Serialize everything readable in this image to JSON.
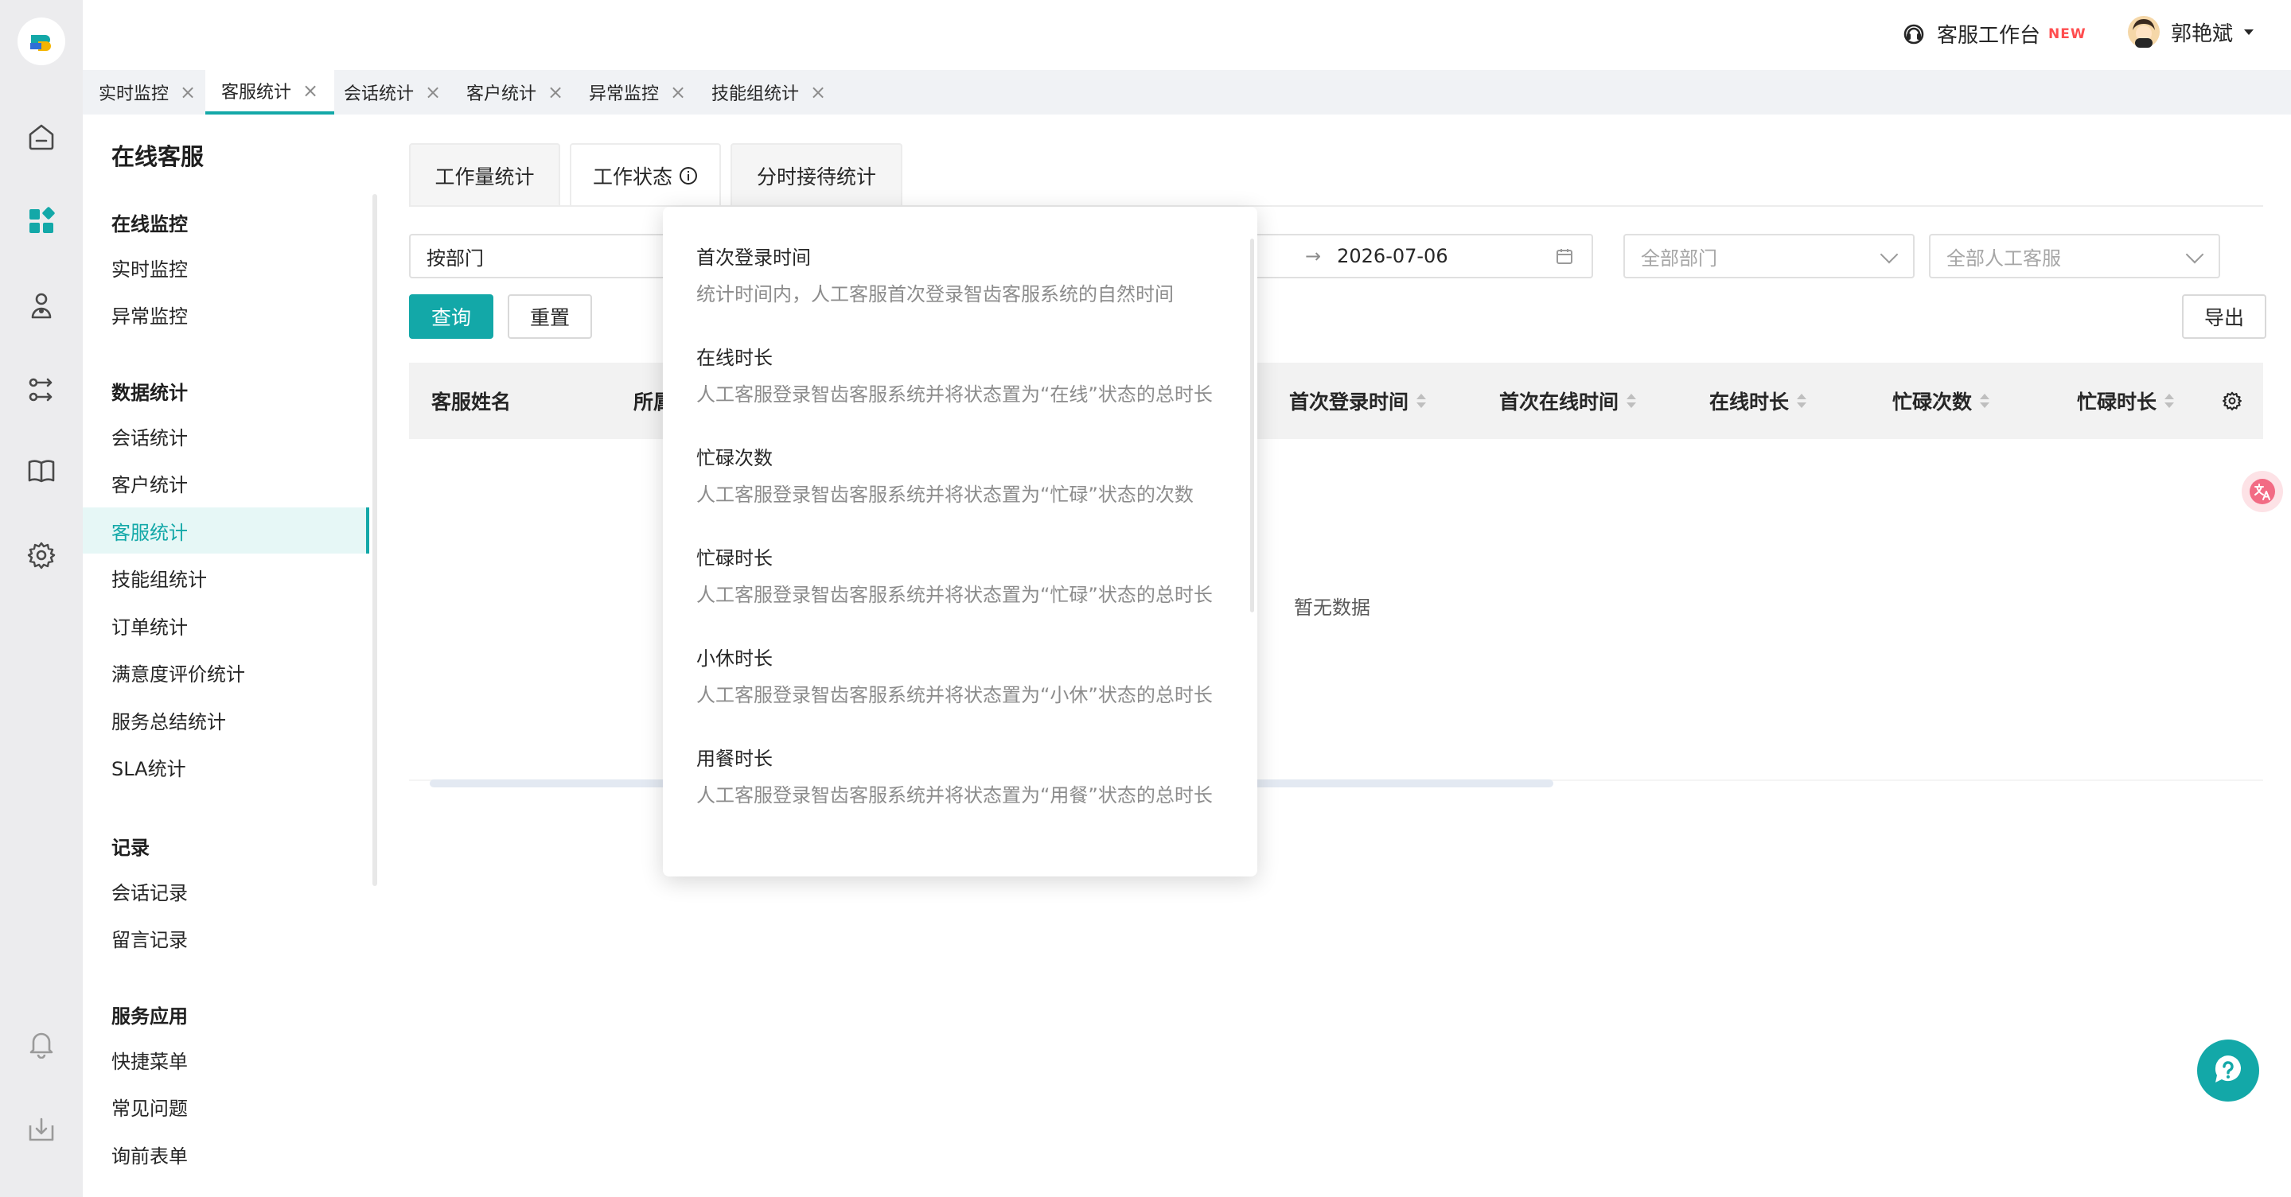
{
  "topbar": {
    "workbench_label": "客服工作台",
    "new_badge": "NEW",
    "user_name": "郭艳斌"
  },
  "page_tabs": [
    {
      "label": "实时监控",
      "active": false
    },
    {
      "label": "客服统计",
      "active": true
    },
    {
      "label": "会话统计",
      "active": false
    },
    {
      "label": "客户统计",
      "active": false
    },
    {
      "label": "异常监控",
      "active": false
    },
    {
      "label": "技能组统计",
      "active": false
    }
  ],
  "menu": {
    "title": "在线客服",
    "groups": [
      {
        "label": "在线监控",
        "items": [
          "实时监控",
          "异常监控"
        ]
      },
      {
        "label": "数据统计",
        "items": [
          "会话统计",
          "客户统计",
          "客服统计",
          "技能组统计",
          "订单统计",
          "满意度评价统计",
          "服务总结统计",
          "SLA统计"
        ]
      },
      {
        "label": "记录",
        "items": [
          "会话记录",
          "留言记录"
        ]
      },
      {
        "label": "服务应用",
        "items": [
          "快捷菜单",
          "常见问题",
          "询前表单"
        ]
      }
    ],
    "active_item": "客服统计"
  },
  "subtabs": [
    {
      "label": "工作量统计",
      "active": false
    },
    {
      "label": "工作状态",
      "active": true
    },
    {
      "label": "分时接待统计",
      "active": false
    }
  ],
  "filters": {
    "group_by": "按部门",
    "date_end": "2026-07-06",
    "date_separator": "→",
    "department_placeholder": "全部部门",
    "agent_placeholder": "全部人工客服"
  },
  "buttons": {
    "query": "查询",
    "reset": "重置",
    "export": "导出"
  },
  "table": {
    "columns": [
      "客服姓名",
      "所属",
      "首次登录时间",
      "首次在线时间",
      "在线时长",
      "忙碌次数",
      "忙碌时长"
    ],
    "empty_text": "暂无数据"
  },
  "popover": {
    "items": [
      {
        "title": "首次登录时间",
        "desc": "统计时间内，人工客服首次登录智齿客服系统的自然时间"
      },
      {
        "title": "在线时长",
        "desc": "人工客服登录智齿客服系统并将状态置为“在线”状态的总时长"
      },
      {
        "title": "忙碌次数",
        "desc": "人工客服登录智齿客服系统并将状态置为“忙碌”状态的次数"
      },
      {
        "title": "忙碌时长",
        "desc": "人工客服登录智齿客服系统并将状态置为“忙碌”状态的总时长"
      },
      {
        "title": "小休时长",
        "desc": "人工客服登录智齿客服系统并将状态置为“小休”状态的总时长"
      },
      {
        "title": "用餐时长",
        "desc": "人工客服登录智齿客服系统并将状态置为“用餐”状态的总时长"
      }
    ]
  },
  "colors": {
    "accent": "#13a8a8",
    "rail_bg": "#ececee",
    "danger": "#ff4d4f"
  },
  "icons": [
    "logo-icon",
    "home-icon",
    "dashboard-icon",
    "customer-icon",
    "transfer-icon",
    "knowledge-book-icon",
    "settings-gear-icon",
    "bell-icon",
    "download-icon",
    "headset-icon",
    "calendar-icon",
    "info-icon",
    "column-settings-icon",
    "translate-icon",
    "help-icon"
  ]
}
